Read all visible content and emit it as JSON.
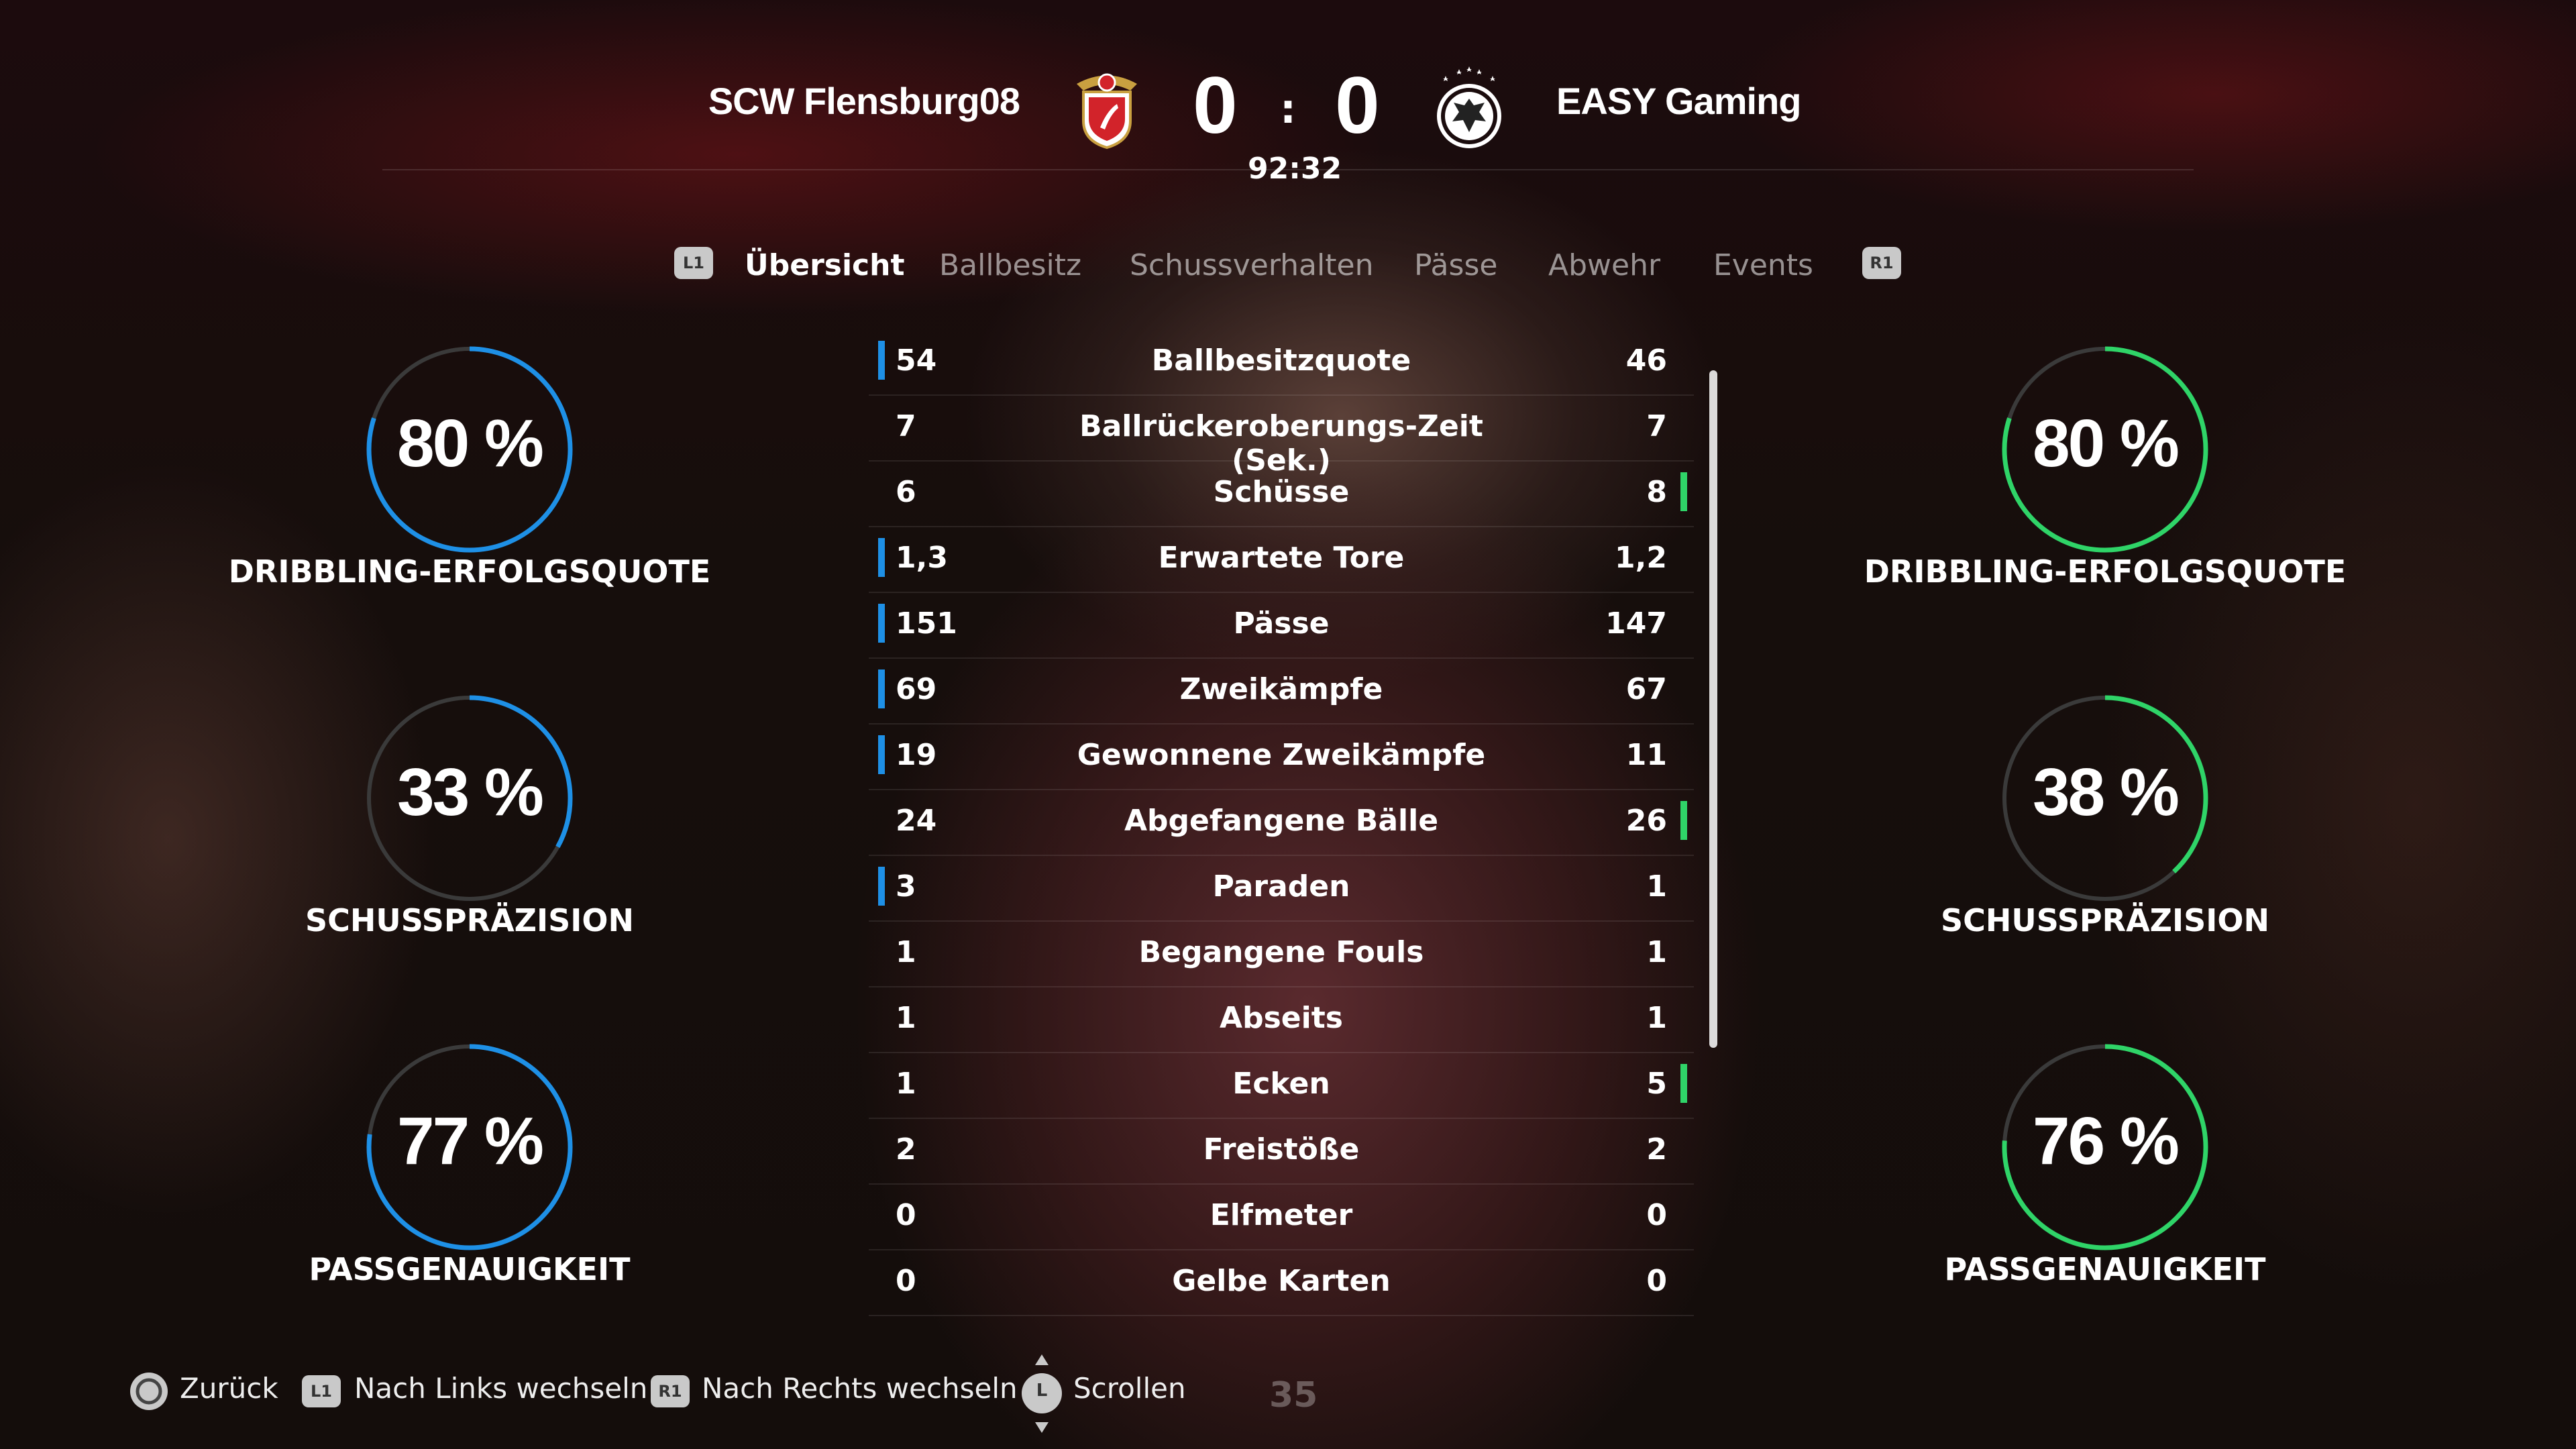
{
  "match": {
    "home_team": "SCW Flensburg08",
    "away_team": "EASY Gaming",
    "home_score": "0",
    "away_score": "0",
    "separator": ":",
    "clock": "92:32"
  },
  "tabs": {
    "left_button": "L1",
    "right_button": "R1",
    "items": [
      "Übersicht",
      "Ballbesitz",
      "Schussverhalten",
      "Pässe",
      "Abwehr",
      "Events"
    ],
    "active": "Übersicht"
  },
  "stats": [
    {
      "name": "Ballbesitzquote",
      "home": "54",
      "away": "46",
      "leader": "home"
    },
    {
      "name": "Ballrückeroberungs-Zeit (Sek.)",
      "home": "7",
      "away": "7",
      "leader": "none"
    },
    {
      "name": "Schüsse",
      "home": "6",
      "away": "8",
      "leader": "away"
    },
    {
      "name": "Erwartete Tore",
      "home": "1,3",
      "away": "1,2",
      "leader": "home"
    },
    {
      "name": "Pässe",
      "home": "151",
      "away": "147",
      "leader": "home"
    },
    {
      "name": "Zweikämpfe",
      "home": "69",
      "away": "67",
      "leader": "home"
    },
    {
      "name": "Gewonnene Zweikämpfe",
      "home": "19",
      "away": "11",
      "leader": "home"
    },
    {
      "name": "Abgefangene Bälle",
      "home": "24",
      "away": "26",
      "leader": "away"
    },
    {
      "name": "Paraden",
      "home": "3",
      "away": "1",
      "leader": "home"
    },
    {
      "name": "Begangene Fouls",
      "home": "1",
      "away": "1",
      "leader": "none"
    },
    {
      "name": "Abseits",
      "home": "1",
      "away": "1",
      "leader": "none"
    },
    {
      "name": "Ecken",
      "home": "1",
      "away": "5",
      "leader": "away"
    },
    {
      "name": "Freistöße",
      "home": "2",
      "away": "2",
      "leader": "none"
    },
    {
      "name": "Elfmeter",
      "home": "0",
      "away": "0",
      "leader": "none"
    },
    {
      "name": "Gelbe Karten",
      "home": "0",
      "away": "0",
      "leader": "none"
    }
  ],
  "gauges": {
    "home": [
      {
        "value": 80,
        "text": "80 %",
        "label": "DRIBBLING-ERFOLGSQUOTE"
      },
      {
        "value": 33,
        "text": "33 %",
        "label": "SCHUSSPRÄZISION"
      },
      {
        "value": 77,
        "text": "77 %",
        "label": "PASSGENAUIGKEIT"
      }
    ],
    "away": [
      {
        "value": 80,
        "text": "80 %",
        "label": "DRIBBLING-ERFOLGSQUOTE"
      },
      {
        "value": 38,
        "text": "38 %",
        "label": "SCHUSSPRÄZISION"
      },
      {
        "value": 76,
        "text": "76 %",
        "label": "PASSGENAUIGKEIT"
      }
    ]
  },
  "colors": {
    "home_accent": "#1e90e6",
    "away_accent": "#2fd468",
    "ring_track": "#3a3a3a"
  },
  "footer": {
    "back": "Zurück",
    "left": "Nach Links wechseln",
    "left_btn": "L1",
    "right": "Nach Rechts wechseln",
    "right_btn": "R1",
    "scroll": "Scrollen",
    "scroll_btn": "L",
    "page": "35"
  },
  "icons": {
    "home_crest": "flensburg-crest-icon",
    "away_crest": "germany-eagle-crest-icon",
    "back": "circle-button-icon",
    "scroll": "left-stick-icon"
  }
}
